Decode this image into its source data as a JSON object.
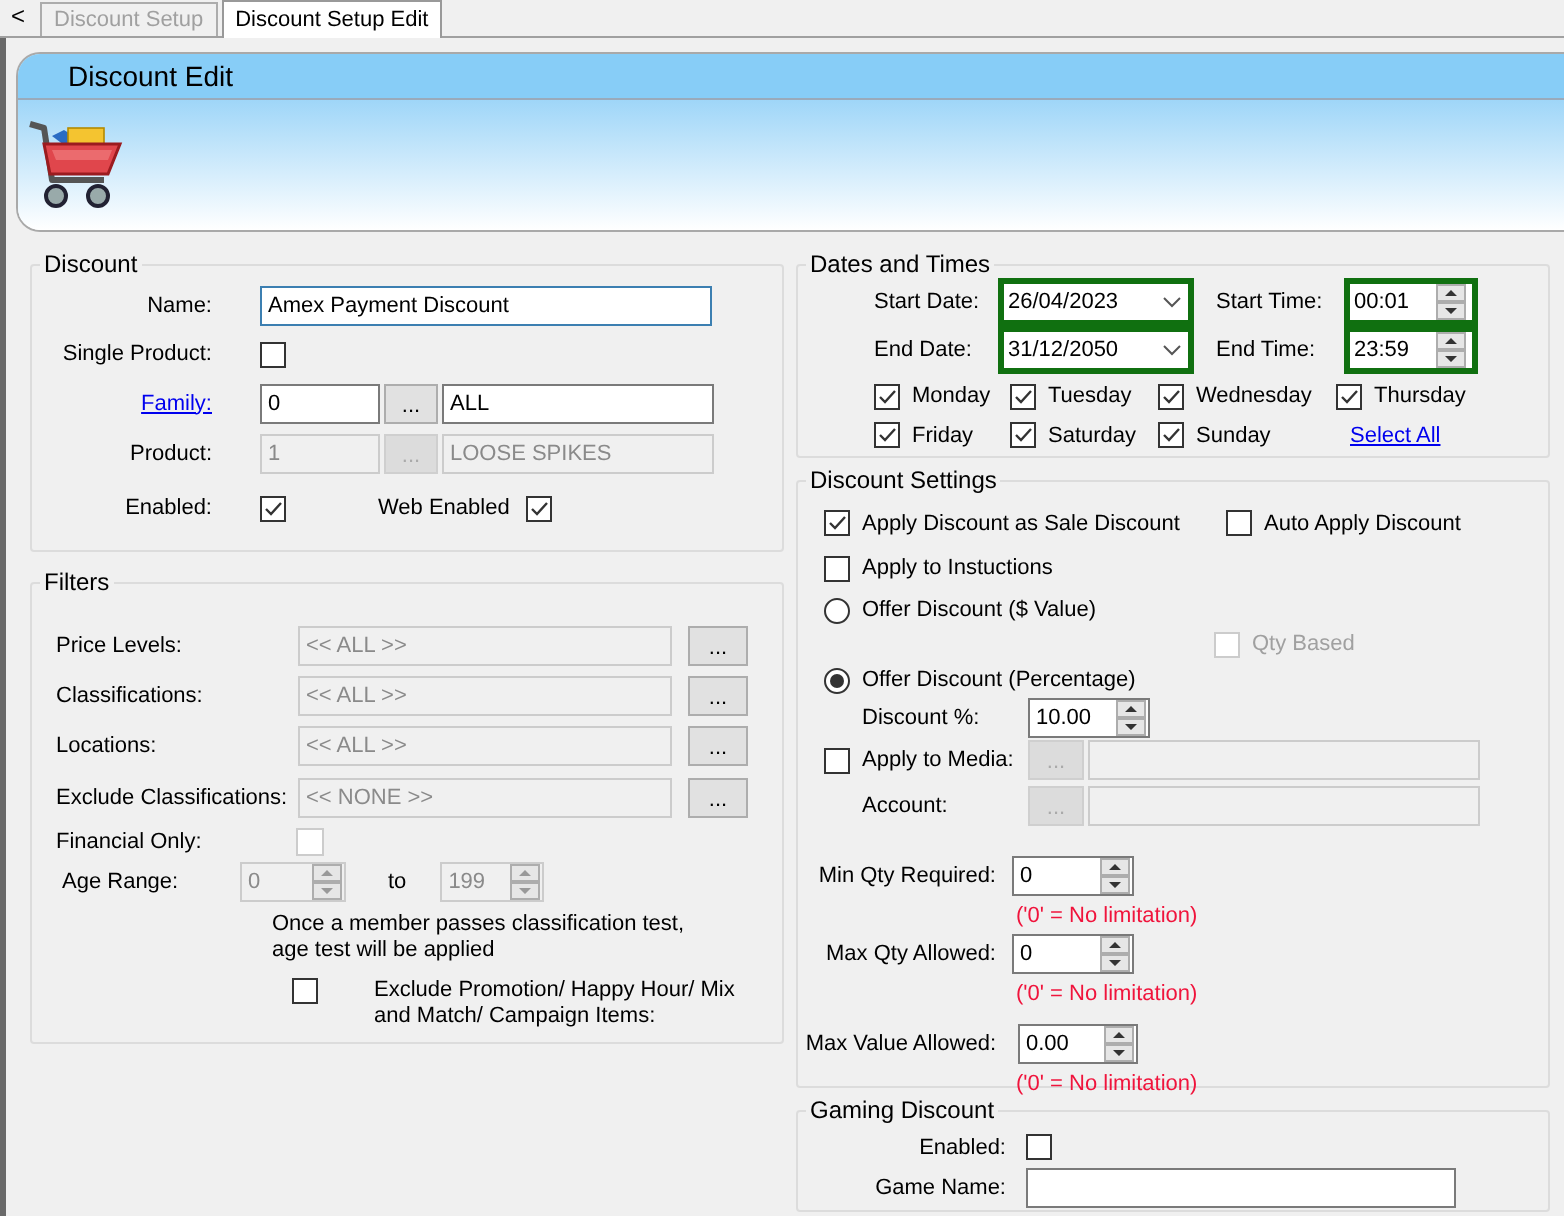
{
  "back": "<",
  "tabs": [
    {
      "label": "Discount Setup",
      "selected": false
    },
    {
      "label": "Discount Setup Edit",
      "selected": true
    }
  ],
  "header": {
    "title": "Discount Edit"
  },
  "discount": {
    "title": "Discount",
    "name": {
      "label": "Name:",
      "value": "Amex Payment Discount"
    },
    "single_product": {
      "label": "Single Product:",
      "checked": false
    },
    "family": {
      "label": "Family:",
      "code": "0",
      "browse": "...",
      "value": "ALL",
      "disabled": false
    },
    "product": {
      "label": "Product:",
      "code": "1",
      "browse": "...",
      "value": "LOOSE SPIKES",
      "disabled": true
    },
    "enabled": {
      "label": "Enabled:",
      "checked": true
    },
    "web_enabled": {
      "label": "Web Enabled",
      "checked": true
    }
  },
  "filters": {
    "title": "Filters",
    "rows": [
      {
        "label": "Price Levels:",
        "value": "<< ALL >>",
        "browse": "..."
      },
      {
        "label": "Classifications:",
        "value": "<< ALL >>",
        "browse": "..."
      },
      {
        "label": "Locations:",
        "value": "<< ALL >>",
        "browse": "..."
      },
      {
        "label": "Exclude Classifications:",
        "value": "<< NONE >>",
        "browse": "..."
      }
    ],
    "financial_only": {
      "label": "Financial Only:",
      "checked": false,
      "disabled": true
    },
    "age_range": {
      "label": "Age Range:",
      "from": "0",
      "to_label": "to",
      "to": "199",
      "disabled": true
    },
    "note": "Once a member passes classification test, age test will be applied",
    "exclude_promotion": {
      "label": "Exclude Promotion/ Happy Hour/ Mix and Match/ Campaign Items:",
      "checked": false
    }
  },
  "dates": {
    "title": "Dates and Times",
    "start_date": {
      "label": "Start Date:",
      "value": "26/04/2023"
    },
    "start_time": {
      "label": "Start Time:",
      "value": "00:01"
    },
    "end_date": {
      "label": "End Date:",
      "value": "31/12/2050"
    },
    "end_time": {
      "label": "End Time:",
      "value": "23:59"
    },
    "days": [
      {
        "label": "Monday",
        "checked": true
      },
      {
        "label": "Tuesday",
        "checked": true
      },
      {
        "label": "Wednesday",
        "checked": true
      },
      {
        "label": "Thursday",
        "checked": true
      },
      {
        "label": "Friday",
        "checked": true
      },
      {
        "label": "Saturday",
        "checked": true
      },
      {
        "label": "Sunday",
        "checked": true
      }
    ],
    "select_all": "Select All"
  },
  "settings": {
    "title": "Discount Settings",
    "sale_discount": {
      "label": "Apply Discount as Sale Discount",
      "checked": true
    },
    "auto_apply": {
      "label": "Auto Apply Discount",
      "checked": false
    },
    "instructions": {
      "label": "Apply to Instuctions",
      "checked": false
    },
    "offer_value": {
      "label": "Offer Discount ($ Value)",
      "selected": false
    },
    "qty_based": {
      "label": "Qty Based",
      "checked": false,
      "disabled": true
    },
    "offer_percentage": {
      "label": "Offer Discount (Percentage)",
      "selected": true
    },
    "discount_pct": {
      "label": "Discount %:",
      "value": "10.00"
    },
    "apply_media": {
      "label": "Apply to Media:",
      "checked": false,
      "browse": "..."
    },
    "account": {
      "label": "Account:",
      "browse": "..."
    },
    "limits": [
      {
        "label": "Min Qty Required:",
        "value": "0",
        "note": "('0' = No limitation)"
      },
      {
        "label": "Max Qty Allowed:",
        "value": "0",
        "note": "('0' = No limitation)"
      },
      {
        "label": "Max Value Allowed:",
        "value": "0.00",
        "note": "('0' = No limitation)"
      }
    ]
  },
  "gaming": {
    "title": "Gaming Discount",
    "enabled": {
      "label": "Enabled:",
      "checked": false
    },
    "game_name": {
      "label": "Game Name:"
    }
  }
}
